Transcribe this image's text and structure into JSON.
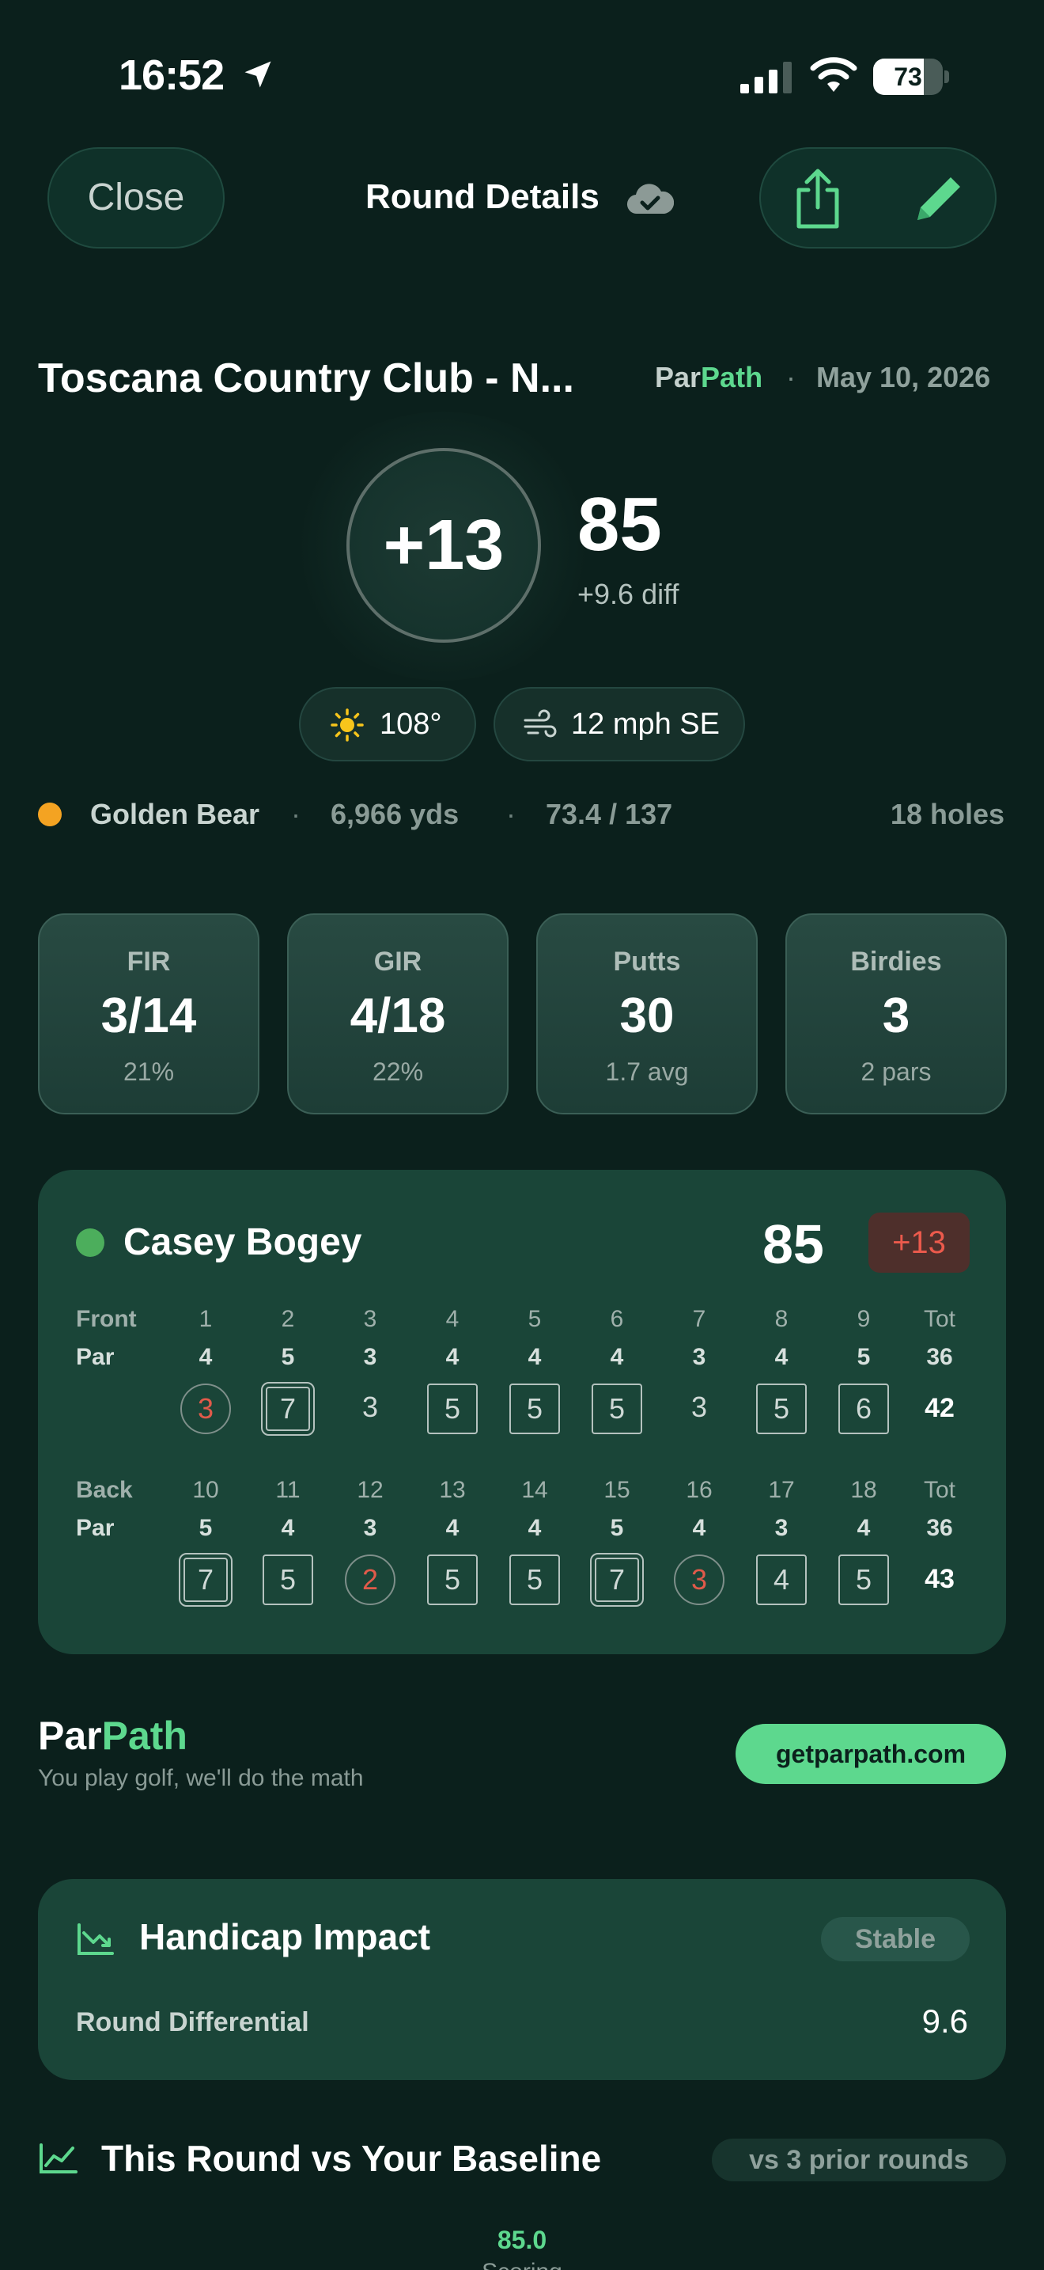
{
  "status_bar": {
    "time": "16:52",
    "battery": "73",
    "battery_level": 0.73
  },
  "nav": {
    "close_label": "Close",
    "title": "Round Details",
    "sync_icon": "cloud-check-icon",
    "share_icon": "share-icon",
    "edit_icon": "pencil-icon"
  },
  "round": {
    "course": "Toscana Country Club - N...",
    "brand_par": "Par",
    "brand_path": "Path",
    "separator": "·",
    "date": "May 10, 2026",
    "to_par": "+13",
    "total": "85",
    "diff": "+9.6 diff"
  },
  "weather": {
    "temp": "108°",
    "wind": "12 mph SE"
  },
  "course_info": {
    "tee": "Golden Bear",
    "yards": "6,966 yds",
    "rating": "73.4 / 137",
    "holes": "18 holes",
    "separator": "·"
  },
  "stats": [
    {
      "label": "FIR",
      "value": "3/14",
      "sub": "21%"
    },
    {
      "label": "GIR",
      "value": "4/18",
      "sub": "22%"
    },
    {
      "label": "Putts",
      "value": "30",
      "sub": "1.7 avg"
    },
    {
      "label": "Birdies",
      "value": "3",
      "sub": "2 pars"
    }
  ],
  "scorecard": {
    "player": "Casey Bogey",
    "total": "85",
    "to_par": "+13",
    "front": {
      "label": "Front",
      "par_label": "Par",
      "holes": [
        "1",
        "2",
        "3",
        "4",
        "5",
        "6",
        "7",
        "8",
        "9"
      ],
      "tot_label": "Tot",
      "pars": [
        "4",
        "5",
        "3",
        "4",
        "4",
        "4",
        "3",
        "4",
        "5"
      ],
      "par_total": "36",
      "scores": [
        "3",
        "7",
        "3",
        "5",
        "5",
        "5",
        "3",
        "5",
        "6"
      ],
      "score_total": "42"
    },
    "back": {
      "label": "Back",
      "par_label": "Par",
      "holes": [
        "10",
        "11",
        "12",
        "13",
        "14",
        "15",
        "16",
        "17",
        "18"
      ],
      "tot_label": "Tot",
      "pars": [
        "5",
        "4",
        "3",
        "4",
        "4",
        "5",
        "4",
        "3",
        "4"
      ],
      "par_total": "36",
      "scores": [
        "7",
        "5",
        "2",
        "5",
        "5",
        "7",
        "3",
        "4",
        "5"
      ],
      "score_total": "43"
    }
  },
  "brand": {
    "par": "Par",
    "path": "Path",
    "tagline": "You play golf, we'll do the math",
    "site": "getparpath.com"
  },
  "handicap": {
    "title": "Handicap Impact",
    "badge": "Stable",
    "label": "Round Differential",
    "value": "9.6"
  },
  "baseline": {
    "title": "This Round vs Your Baseline",
    "badge": "vs 3 prior rounds",
    "value": "85.0",
    "caption": "Scoring"
  },
  "colors": {
    "accent": "#5dd88e",
    "background": "#0b201c",
    "card": "#1a4538",
    "over_par": "#ec5a4c",
    "tee_dot": "#f4a322"
  }
}
